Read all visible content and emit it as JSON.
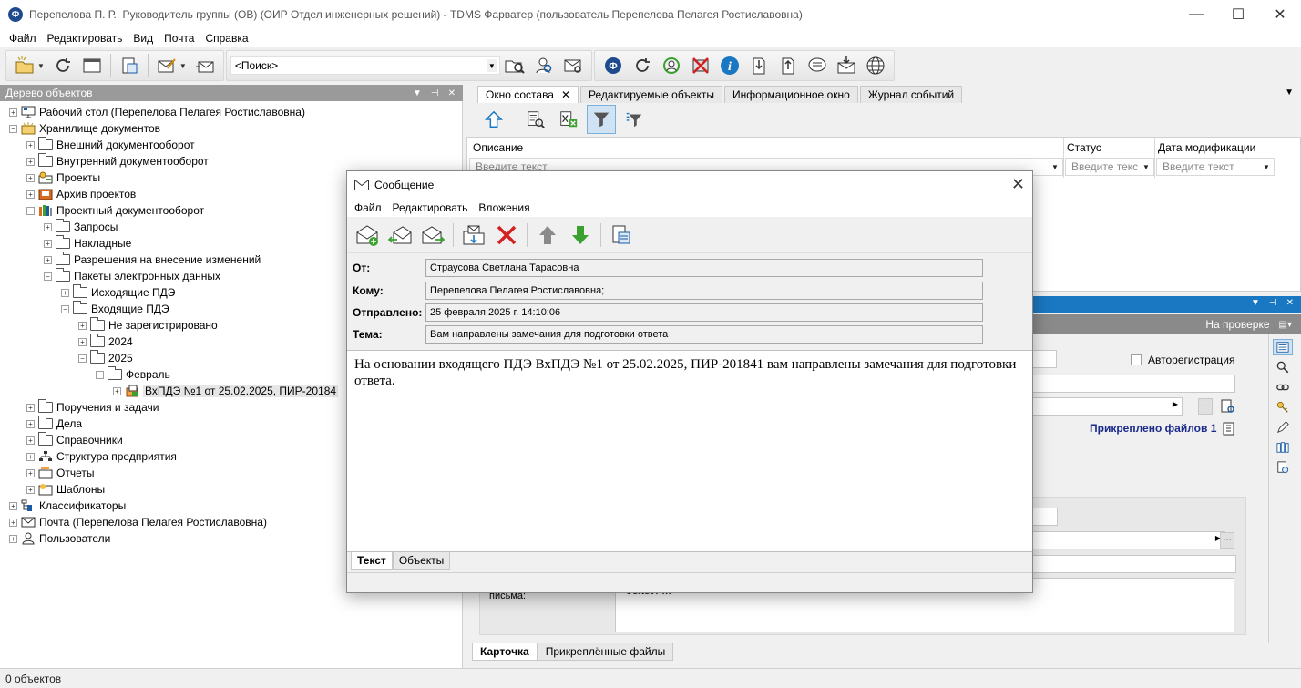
{
  "window": {
    "title": "Перепелова П. Р., Руководитель группы (ОВ) (ОИР Отдел инженерных решений) - TDMS Фарватер (пользователь Перепелова Пелагея Ростиславовна)",
    "minimize": "—",
    "maximize": "☐",
    "close": "✕"
  },
  "menu": [
    "Файл",
    "Редактировать",
    "Вид",
    "Почта",
    "Справка"
  ],
  "toolbar": {
    "search_value": "<Поиск>"
  },
  "left_panel": {
    "header": "Дерево объектов",
    "tree": [
      {
        "label": "Рабочий стол (Перепелова Пелагея Ростиславовна)",
        "level": 0,
        "exp": "+",
        "icon": "desktop-icon"
      },
      {
        "label": "Хранилище документов",
        "level": 0,
        "exp": "−",
        "icon": "storage-icon"
      },
      {
        "label": "Внешний документооборот",
        "level": 1,
        "exp": "+",
        "icon": "folder-icon"
      },
      {
        "label": "Внутренний документооборот",
        "level": 1,
        "exp": "+",
        "icon": "folder-icon"
      },
      {
        "label": "Проекты",
        "level": 1,
        "exp": "+",
        "icon": "projects-icon"
      },
      {
        "label": "Архив проектов",
        "level": 1,
        "exp": "+",
        "icon": "archive-icon"
      },
      {
        "label": "Проектный документооборот",
        "level": 1,
        "exp": "−",
        "icon": "library-icon"
      },
      {
        "label": "Запросы",
        "level": 2,
        "exp": "+",
        "icon": "folder-icon"
      },
      {
        "label": "Накладные",
        "level": 2,
        "exp": "+",
        "icon": "folder-icon"
      },
      {
        "label": "Разрешения на внесение изменений",
        "level": 2,
        "exp": "+",
        "icon": "folder-icon"
      },
      {
        "label": "Пакеты электронных данных",
        "level": 2,
        "exp": "−",
        "icon": "folder-icon"
      },
      {
        "label": "Исходящие ПДЭ",
        "level": 3,
        "exp": "+",
        "icon": "folder-icon"
      },
      {
        "label": "Входящие ПДЭ",
        "level": 3,
        "exp": "−",
        "icon": "folder-icon"
      },
      {
        "label": "Не зарегистрировано",
        "level": 4,
        "exp": "+",
        "icon": "folder-icon"
      },
      {
        "label": "2024",
        "level": 4,
        "exp": "+",
        "icon": "folder-icon"
      },
      {
        "label": "2025",
        "level": 4,
        "exp": "−",
        "icon": "folder-icon"
      },
      {
        "label": "Февраль",
        "level": 5,
        "exp": "−",
        "icon": "folder-icon"
      },
      {
        "label": "ВхПДЭ №1 от 25.02.2025, ПИР-20184",
        "level": 6,
        "exp": "+",
        "icon": "package-icon",
        "selected": true
      },
      {
        "label": "Поручения и задачи",
        "level": 1,
        "exp": "+",
        "icon": "folder-icon"
      },
      {
        "label": "Дела",
        "level": 1,
        "exp": "+",
        "icon": "folder-icon"
      },
      {
        "label": "Справочники",
        "level": 1,
        "exp": "+",
        "icon": "folder-icon"
      },
      {
        "label": "Структура предприятия",
        "level": 1,
        "exp": "+",
        "icon": "structure-icon"
      },
      {
        "label": "Отчеты",
        "level": 1,
        "exp": "+",
        "icon": "reports-icon"
      },
      {
        "label": "Шаблоны",
        "level": 1,
        "exp": "+",
        "icon": "templates-icon"
      },
      {
        "label": "Классификаторы",
        "level": 0,
        "exp": "+",
        "icon": "classifier-icon"
      },
      {
        "label": "Почта (Перепелова Пелагея Ростиславовна)",
        "level": 0,
        "exp": "+",
        "icon": "mail-icon"
      },
      {
        "label": "Пользователи",
        "level": 0,
        "exp": "+",
        "icon": "user-icon"
      }
    ]
  },
  "tabs": [
    {
      "label": "Окно состава",
      "active": true,
      "closable": "✕"
    },
    {
      "label": "Редактируемые объекты"
    },
    {
      "label": "Информационное окно"
    },
    {
      "label": "Журнал событий"
    }
  ],
  "grid": {
    "columns": [
      {
        "label": "Описание",
        "placeholder": "Введите текст"
      },
      {
        "label": "Статус",
        "placeholder": "Введите текс"
      },
      {
        "label": "Дата модификации",
        "placeholder": "Введите текст"
      }
    ]
  },
  "card": {
    "status": "На проверке",
    "autoreg_label": "Авторегистрация",
    "attached_files": "Прикреплено файлов 1",
    "letter_label": "письма:",
    "letter_text": "Текст: ...",
    "bottom_tabs": [
      "Карточка",
      "Прикреплённые файлы"
    ]
  },
  "dialog": {
    "title": "Сообщение",
    "menu": [
      "Файл",
      "Редактировать",
      "Вложения"
    ],
    "from_label": "От:",
    "from_value": "Страусова Светлана Тарасовна",
    "to_label": "Кому:",
    "to_value": "Перепелова Пелагея Ростиславовна;",
    "sent_label": "Отправлено:",
    "sent_value": "25 февраля 2025 г. 14:10:06",
    "subject_label": "Тема:",
    "subject_value": "Вам направлены замечания для подготовки ответа",
    "body": "На основании входящего ПДЭ ВхПДЭ №1 от 25.02.2025, ПИР-201841 вам направлены замечания для подготовки ответа.",
    "tabs": [
      "Текст",
      "Объекты"
    ]
  },
  "status_bar": "0 объектов",
  "colors": {
    "accent": "#1a78c2",
    "attached_text": "#1a2b8c",
    "delete_red": "#d32020",
    "arrow_green": "#3aa030"
  }
}
